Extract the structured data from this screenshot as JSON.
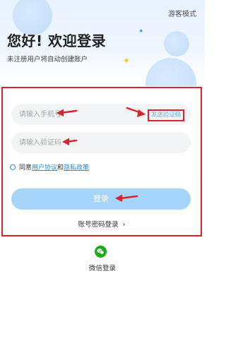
{
  "header": {
    "guest_mode": "游客模式",
    "title": "您好! 欢迎登录",
    "subtitle": "未注册用户将自动创建账户"
  },
  "form": {
    "phone_placeholder": "请输入手机号",
    "code_placeholder": "请输入验证码",
    "send_code": "发送验证码",
    "agree_prefix": "同意",
    "user_agreement": "用户协议",
    "and": "和",
    "privacy_policy": "隐私政策",
    "login_button": "登录",
    "password_login": "账号密码登录",
    "password_login_chevron": "›"
  },
  "social": {
    "wechat_label": "微信登录"
  },
  "colors": {
    "accent": "#2b8de3",
    "button": "#a6d5fb",
    "annotation": "#d9232d",
    "wechat": "#1aad19"
  }
}
